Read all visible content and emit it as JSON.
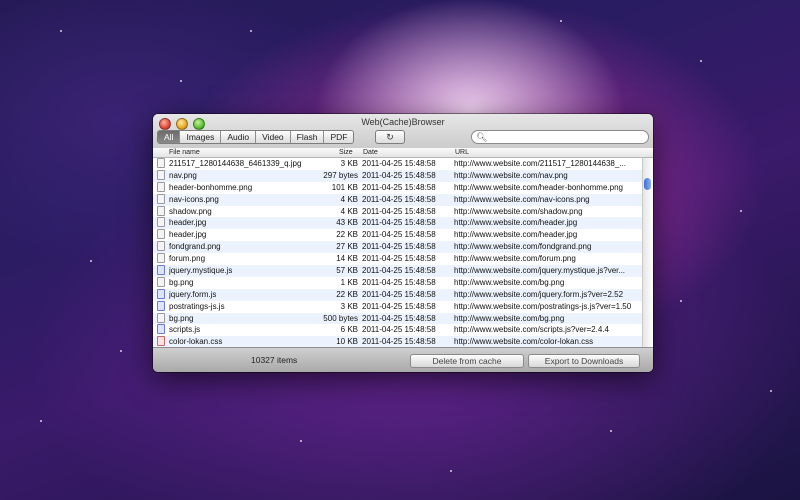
{
  "window": {
    "title": "Web(Cache)Browser"
  },
  "tabs": [
    "All",
    "Images",
    "Audio",
    "Video",
    "Flash",
    "PDF"
  ],
  "active_tab": "All",
  "icons": {
    "refresh": "refresh-icon",
    "search": "search-icon"
  },
  "search": {
    "placeholder": ""
  },
  "columns": {
    "name": "File name",
    "size": "Size",
    "date": "Date",
    "url": "URL"
  },
  "rows": [
    {
      "type": "img",
      "name": "211517_1280144638_6461339_q.jpg",
      "size": "3 KB",
      "date": "2011-04-25 15:48:58",
      "url": "http://www.website.com/211517_1280144638_..."
    },
    {
      "type": "img",
      "name": "nav.png",
      "size": "297 bytes",
      "date": "2011-04-25 15:48:58",
      "url": "http://www.website.com/nav.png"
    },
    {
      "type": "img",
      "name": "header-bonhomme.png",
      "size": "101 KB",
      "date": "2011-04-25 15:48:58",
      "url": "http://www.website.com/header-bonhomme.png"
    },
    {
      "type": "img",
      "name": "nav-icons.png",
      "size": "4 KB",
      "date": "2011-04-25 15:48:58",
      "url": "http://www.website.com/nav-icons.png"
    },
    {
      "type": "img",
      "name": "shadow.png",
      "size": "4 KB",
      "date": "2011-04-25 15:48:58",
      "url": "http://www.website.com/shadow.png"
    },
    {
      "type": "img",
      "name": "header.jpg",
      "size": "43 KB",
      "date": "2011-04-25 15:48:58",
      "url": "http://www.website.com/header.jpg"
    },
    {
      "type": "img",
      "name": "header.jpg",
      "size": "22 KB",
      "date": "2011-04-25 15:48:58",
      "url": "http://www.website.com/header.jpg"
    },
    {
      "type": "img",
      "name": "fondgrand.png",
      "size": "27 KB",
      "date": "2011-04-25 15:48:58",
      "url": "http://www.website.com/fondgrand.png"
    },
    {
      "type": "img",
      "name": "forum.png",
      "size": "14 KB",
      "date": "2011-04-25 15:48:58",
      "url": "http://www.website.com/forum.png"
    },
    {
      "type": "js",
      "name": "jquery.mystique.js",
      "size": "57 KB",
      "date": "2011-04-25 15:48:58",
      "url": "http://www.website.com/jquery.mystique.js?ver..."
    },
    {
      "type": "img",
      "name": "bg.png",
      "size": "1 KB",
      "date": "2011-04-25 15:48:58",
      "url": "http://www.website.com/bg.png"
    },
    {
      "type": "js",
      "name": "jquery.form.js",
      "size": "22 KB",
      "date": "2011-04-25 15:48:58",
      "url": "http://www.website.com/jquery.form.js?ver=2.52"
    },
    {
      "type": "js",
      "name": "postratings-js.js",
      "size": "3 KB",
      "date": "2011-04-25 15:48:58",
      "url": "http://www.website.com/postratings-js.js?ver=1.50"
    },
    {
      "type": "img",
      "name": "bg.png",
      "size": "500 bytes",
      "date": "2011-04-25 15:48:58",
      "url": "http://www.website.com/bg.png"
    },
    {
      "type": "js",
      "name": "scripts.js",
      "size": "6 KB",
      "date": "2011-04-25 15:48:58",
      "url": "http://www.website.com/scripts.js?ver=2.4.4"
    },
    {
      "type": "css",
      "name": "color-lokan.css",
      "size": "10 KB",
      "date": "2011-04-25 15:48:58",
      "url": "http://www.website.com/color-lokan.css"
    }
  ],
  "footer": {
    "count": "10327 items",
    "delete_label": "Delete from cache",
    "export_label": "Export to Downloads"
  }
}
